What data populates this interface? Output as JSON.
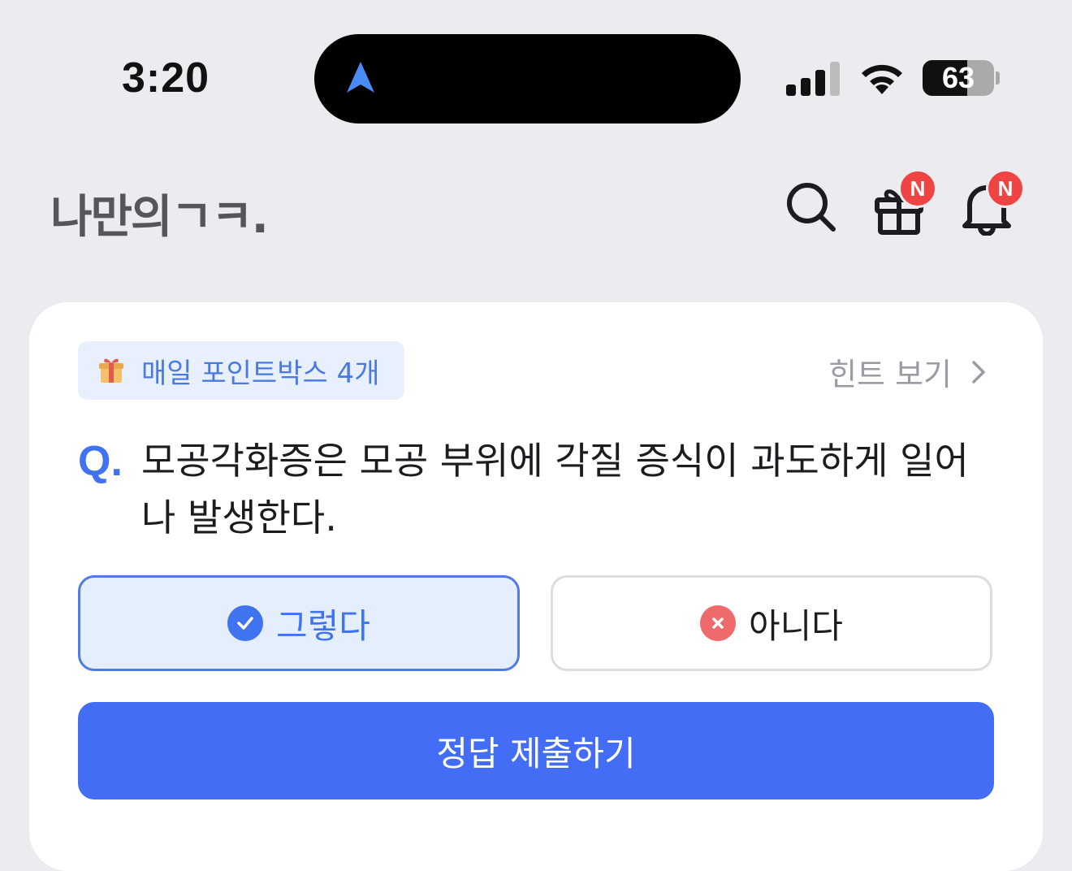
{
  "status_bar": {
    "time": "3:20",
    "battery": "63",
    "battery_level_percent": 63,
    "icons": [
      "navigation-arrow-icon",
      "signal-icon",
      "wifi-icon",
      "battery-icon"
    ]
  },
  "header": {
    "logo": "나만의ㄱㅋ.",
    "icons": [
      "search-icon",
      "gift-icon",
      "bell-icon"
    ],
    "gift_badge": "N",
    "bell_badge": "N"
  },
  "quiz": {
    "daily_pill": "매일 포인트박스 4개",
    "hint_label": "힌트 보기",
    "q_mark": "Q.",
    "question": "모공각화증은 모공 부위에 각질 증식이 과도하게 일어나 발생한다.",
    "answer_yes": "그렇다",
    "answer_no": "아니다",
    "selected": "그렇다",
    "submit_label": "정답 제출하기"
  },
  "colors": {
    "accent": "#436df4",
    "badge": "#ef4444",
    "error": "#ef6a6a",
    "background": "#ebecf0"
  }
}
